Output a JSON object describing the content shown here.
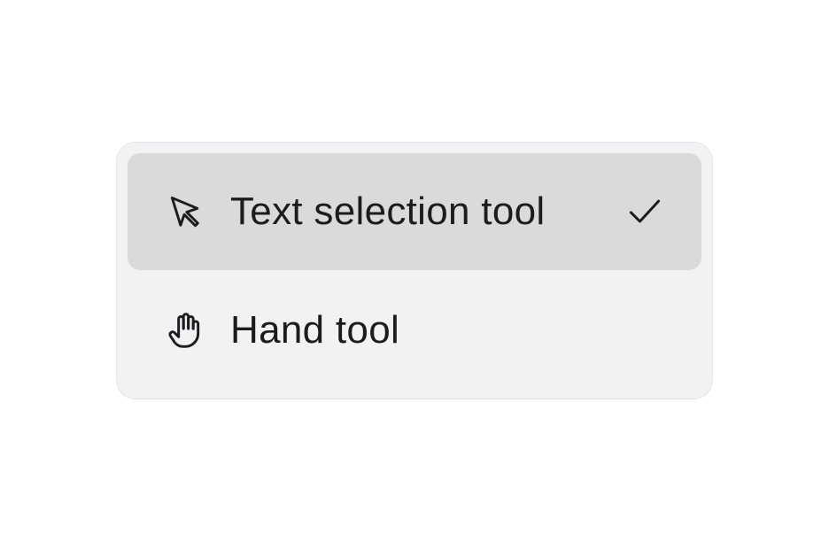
{
  "menu": {
    "items": [
      {
        "label": "Text selection tool",
        "icon": "cursor-arrow-icon",
        "selected": true
      },
      {
        "label": "Hand tool",
        "icon": "hand-icon",
        "selected": false
      }
    ],
    "selected_indicator_icon": "checkmark-icon"
  },
  "colors": {
    "menu_background": "#f0f2f4",
    "menu_border": "#e2e4e7",
    "selected_background": "#d9dadc",
    "text": "#1c1c1e"
  }
}
